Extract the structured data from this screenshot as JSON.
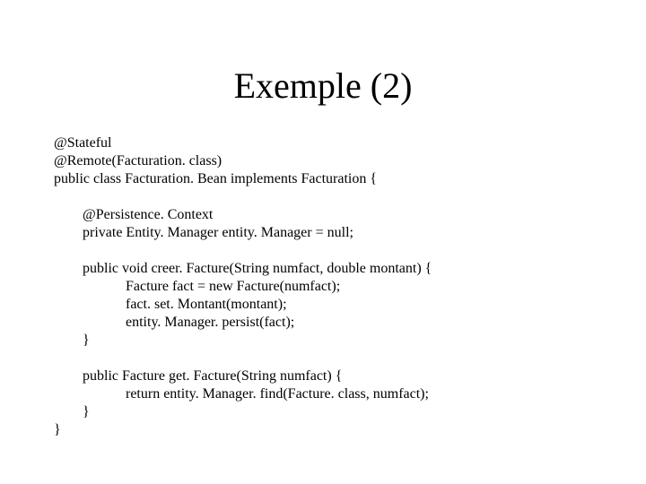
{
  "title": "Exemple (2)",
  "code": {
    "l1": "@Stateful",
    "l2": "@Remote(Facturation. class)",
    "l3": "public class Facturation. Bean implements Facturation {",
    "l4": "",
    "l5": "        @Persistence. Context",
    "l6": "        private Entity. Manager entity. Manager = null;",
    "l7": "",
    "l8": "        public void creer. Facture(String numfact, double montant) {",
    "l9": "                    Facture fact = new Facture(numfact);",
    "l10": "                    fact. set. Montant(montant);",
    "l11": "                    entity. Manager. persist(fact);",
    "l12": "        }",
    "l13": "",
    "l14": "        public Facture get. Facture(String numfact) {",
    "l15": "                    return entity. Manager. find(Facture. class, numfact);",
    "l16": "        }",
    "l17": "}"
  }
}
